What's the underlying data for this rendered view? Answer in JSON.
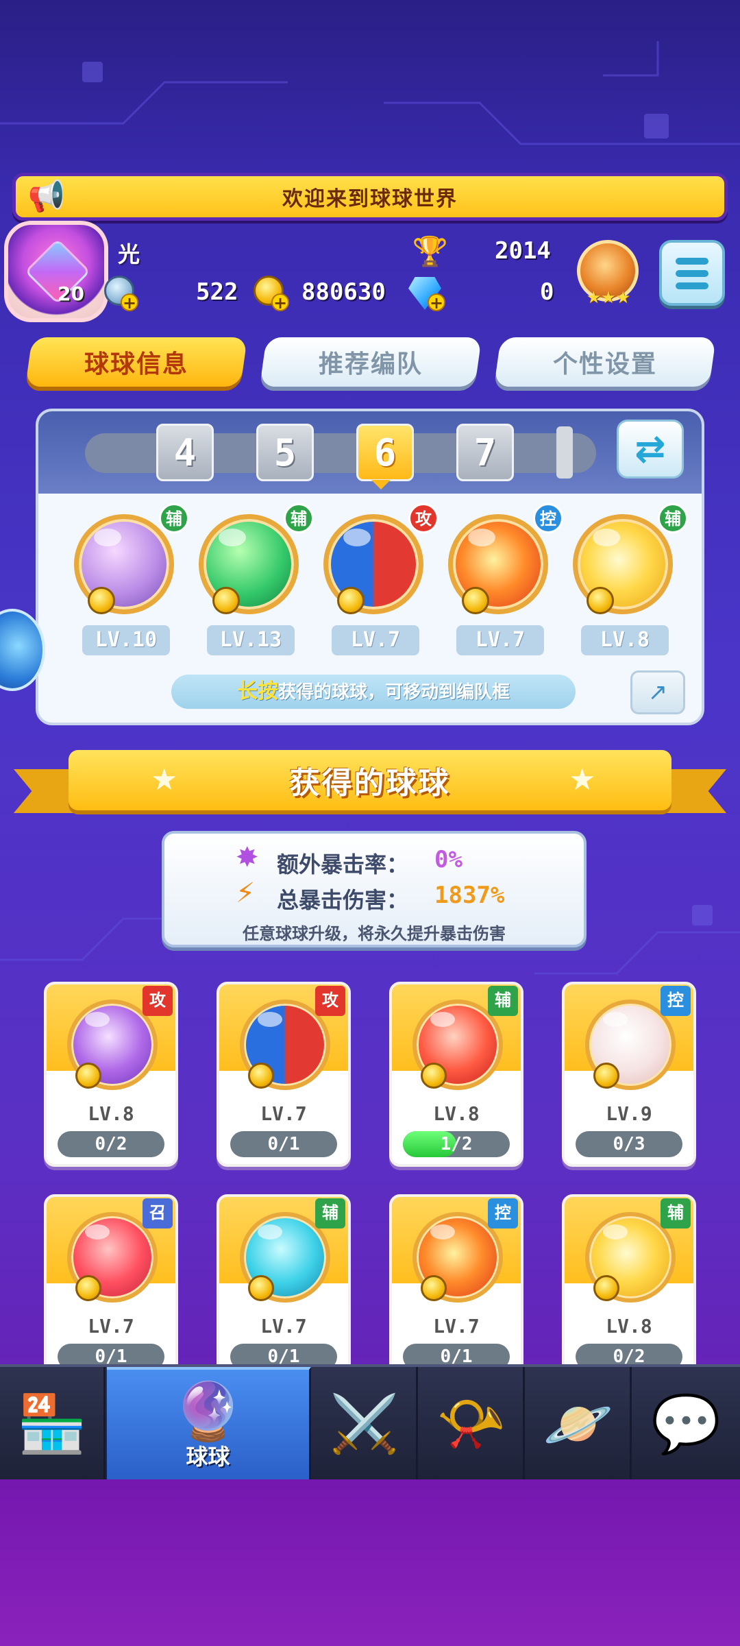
{
  "banner": {
    "text": "欢迎来到球球世界"
  },
  "player": {
    "name": "光",
    "level": "20",
    "coins": "522",
    "gold": "880630",
    "trophies": "2014",
    "gems": "0",
    "rank_stars": "★★★"
  },
  "tabs": [
    {
      "label": "球球信息",
      "active": true
    },
    {
      "label": "推荐编队",
      "active": false
    },
    {
      "label": "个性设置",
      "active": false
    }
  ],
  "team_selector": {
    "numbers": [
      "4",
      "5",
      "6",
      "7"
    ],
    "selected": "6"
  },
  "team_slots": [
    {
      "type": "辅",
      "level": "LV.10"
    },
    {
      "type": "辅",
      "level": "LV.13"
    },
    {
      "type": "攻",
      "level": "LV.7"
    },
    {
      "type": "控",
      "level": "LV.7"
    },
    {
      "type": "辅",
      "level": "LV.8"
    }
  ],
  "hint": {
    "highlight": "长按",
    "text": "获得的球球，可移动到编队框"
  },
  "section_title": "获得的球球",
  "crit": {
    "extra_rate_label": "额外暴击率：",
    "extra_rate_value": "0%",
    "total_damage_label": "总暴击伤害：",
    "total_damage_value": "1837%",
    "note": "任意球球升级，将永久提升暴击伤害"
  },
  "cards": [
    {
      "type": "攻",
      "level": "LV.8",
      "progress": "0/2",
      "fill": 0
    },
    {
      "type": "攻",
      "level": "LV.7",
      "progress": "0/1",
      "fill": 0
    },
    {
      "type": "辅",
      "level": "LV.8",
      "progress": "1/2",
      "fill": 0.5
    },
    {
      "type": "控",
      "level": "LV.9",
      "progress": "0/3",
      "fill": 0
    },
    {
      "type": "召",
      "level": "LV.7",
      "progress": "0/1",
      "fill": 0
    },
    {
      "type": "辅",
      "level": "LV.7",
      "progress": "0/1",
      "fill": 0
    },
    {
      "type": "控",
      "level": "LV.7",
      "progress": "0/1",
      "fill": 0
    },
    {
      "type": "辅",
      "level": "LV.8",
      "progress": "0/2",
      "fill": 0
    }
  ],
  "nav": [
    {
      "icon": "shop-icon",
      "label": ""
    },
    {
      "icon": "balls-icon",
      "label": "球球",
      "active": true
    },
    {
      "icon": "battle-icon",
      "label": ""
    },
    {
      "icon": "whistle-icon",
      "label": ""
    },
    {
      "icon": "planet-icon",
      "label": ""
    },
    {
      "icon": "chat-icon",
      "label": ""
    }
  ],
  "colors": {
    "support": "#2ea34a",
    "attack": "#e2352c",
    "control": "#2b8fe0",
    "summon": "#4a6cd8",
    "accent_yellow": "#ffc21a"
  }
}
